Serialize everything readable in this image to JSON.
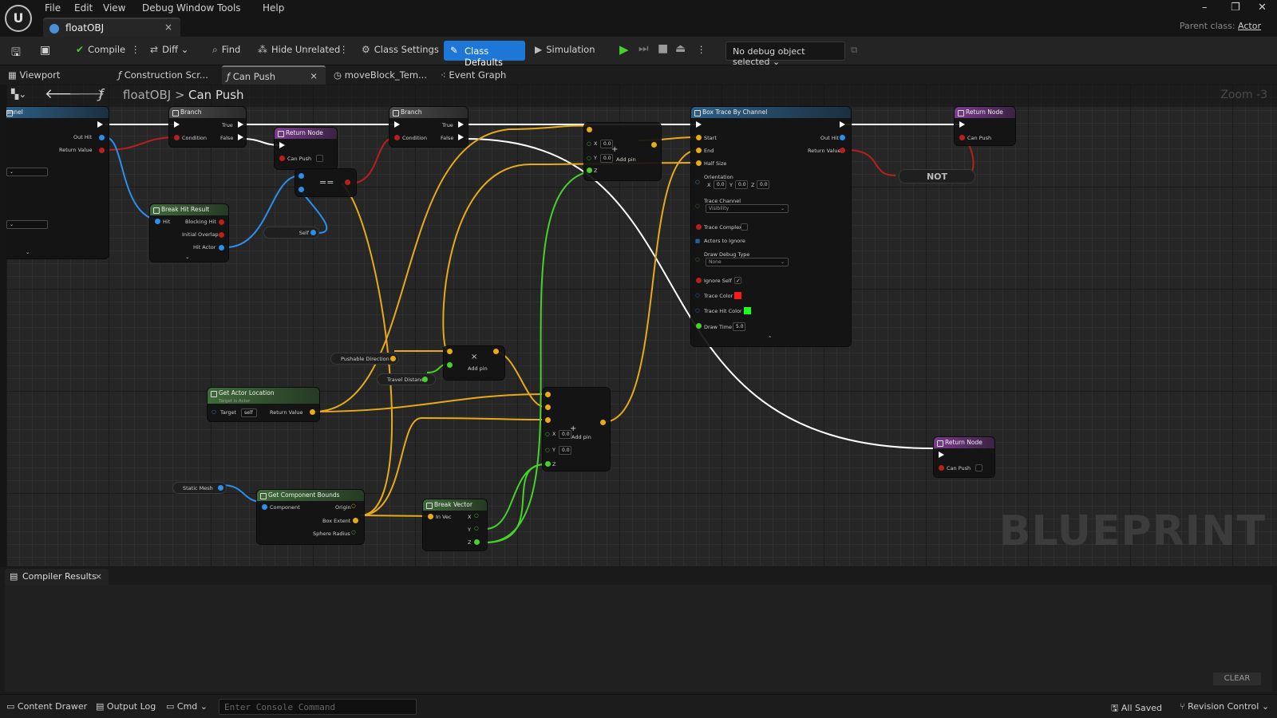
{
  "menu": [
    "File",
    "Edit",
    "View",
    "Debug",
    "Window",
    "Tools",
    "Help"
  ],
  "doc_tab": {
    "title": "floatOBJ",
    "close": "×"
  },
  "window_controls": {
    "minimize": "–",
    "restore": "❐",
    "close": "✕"
  },
  "parent_class": {
    "label": "Parent class:",
    "value": "Actor"
  },
  "toolbar": {
    "compile": "Compile",
    "diff": "Diff",
    "find": "Find",
    "hide_unrelated": "Hide Unrelated",
    "class_settings": "Class Settings",
    "class_defaults": "Class Defaults",
    "simulation": "Simulation",
    "debug_object": "No debug object selected"
  },
  "editor_tabs": [
    {
      "label": "Viewport",
      "icon": "viewport-icon"
    },
    {
      "label": "Construction Scr...",
      "icon": "function-icon"
    },
    {
      "label": "Can Push",
      "icon": "function-icon",
      "close": "×"
    },
    {
      "label": "moveBlock_Tem...",
      "icon": "clock-icon"
    },
    {
      "label": "Event Graph",
      "icon": "graph-icon"
    }
  ],
  "breadcrumb": {
    "root": "floatOBJ",
    "sep": ">",
    "current": "Can Push",
    "fn": "ƒ"
  },
  "zoom": "Zoom -3",
  "watermark": "BLUEPRINT",
  "nodes": {
    "left_partial": {
      "title": "annel",
      "out_hit": "Out Hit",
      "return_value": "Return Value"
    },
    "branch1": {
      "title": "Branch",
      "true": "True",
      "condition": "Condition",
      "false": "False"
    },
    "return1": {
      "title": "Return Node",
      "can_push": "Can Push"
    },
    "equals": {
      "op": "=="
    },
    "self_node": {
      "label": "Self"
    },
    "break_hit": {
      "title": "Break Hit Result",
      "hit": "Hit",
      "blocking_hit": "Blocking Hit",
      "initial_overlap": "Initial Overlap",
      "hit_actor": "Hit Actor"
    },
    "branch2": {
      "title": "Branch",
      "true": "True",
      "condition": "Condition",
      "false": "False"
    },
    "add_top": {
      "x_label": "X",
      "x_val": "0.0",
      "y_label": "Y",
      "y_val": "0.0",
      "z_label": "Z",
      "add_pin": "Add pin"
    },
    "box_trace": {
      "title": "Box Trace By Channel",
      "start": "Start",
      "end": "End",
      "half_size": "Half Size",
      "orientation": "Orientation",
      "ox": "0.0",
      "oy": "0.0",
      "oz": "0.0",
      "trace_channel": "Trace Channel",
      "trace_channel_value": "Visibility",
      "trace_complex": "Trace Complex",
      "actors_to_ignore": "Actors to Ignore",
      "draw_debug_type": "Draw Debug Type",
      "draw_debug_value": "None",
      "ignore_self": "Ignore Self",
      "trace_color": "Trace Color",
      "trace_hit_color": "Trace Hit Color",
      "draw_time": "Draw Time",
      "draw_time_value": "5.0",
      "out_hit": "Out Hit",
      "return_value": "Return Value"
    },
    "return2": {
      "title": "Return Node",
      "can_push": "Can Push"
    },
    "not": {
      "label": "NOT"
    },
    "pushable_direction": {
      "label": "Pushable Direction"
    },
    "travel_distance": {
      "label": "Travel Distance"
    },
    "multiply": {
      "op": "×",
      "add_pin": "Add pin"
    },
    "get_actor_location": {
      "title": "Get Actor Location",
      "subtitle": "Target is Actor",
      "target": "Target",
      "target_value": "self",
      "return_value": "Return Value"
    },
    "add_mid": {
      "x_label": "X",
      "x_val": "0.0",
      "y_label": "Y",
      "y_val": "0.0",
      "z_label": "Z",
      "add_pin": "Add pin"
    },
    "return3": {
      "title": "Return Node",
      "can_push": "Can Push"
    },
    "static_mesh": {
      "label": "Static Mesh"
    },
    "get_bounds": {
      "title": "Get Component Bounds",
      "component": "Component",
      "origin": "Origin",
      "box_extent": "Box Extent",
      "sphere_radius": "Sphere Radius"
    },
    "break_vector": {
      "title": "Break Vector",
      "in_vec": "In Vec",
      "x": "X",
      "y": "Y",
      "z": "Z"
    }
  },
  "colors": {
    "exec": "#ffffff",
    "bool": "#b8201e",
    "object": "#2b8ff0",
    "vector": "#e8aa18",
    "float": "#46d12b",
    "accent": "#1e77d6",
    "trace_color": "#ff1a1a",
    "trace_hit_color": "#19ff19"
  },
  "compiler": {
    "tab": "Compiler Results",
    "close": "×",
    "clear": "CLEAR"
  },
  "status": {
    "content_drawer": "Content Drawer",
    "output_log": "Output Log",
    "cmd": "Cmd",
    "console_placeholder": "Enter Console Command",
    "all_saved": "All Saved",
    "revision_control": "Revision Control"
  }
}
